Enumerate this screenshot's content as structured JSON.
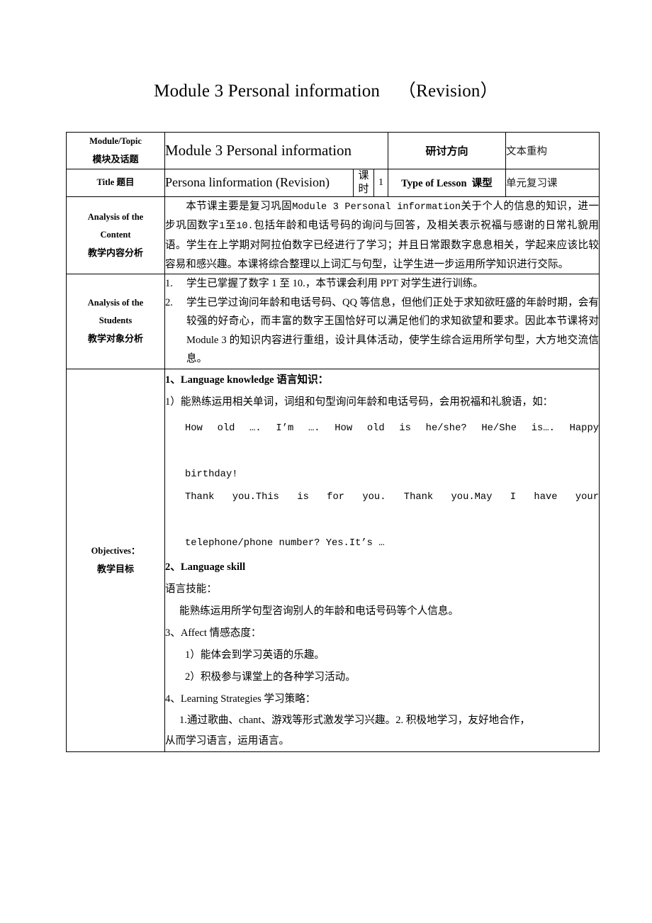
{
  "document": {
    "title": "Module 3 Personal information    （Revision）"
  },
  "table": {
    "row_module": {
      "label_en": "Module/Topic",
      "label_cn": "模块及话题",
      "value": "Module 3 Personal information",
      "direction_label": "研讨方向",
      "direction_value": "文本重构"
    },
    "row_title": {
      "label": "Title  题目",
      "value": "Persona linformation (Revision)",
      "hours_label_1": "课",
      "hours_label_2": "时",
      "hours_value": "1",
      "type_label": "Type of Lesson  课型",
      "type_value": "单元复习课"
    },
    "row_content": {
      "label_en_line1": "Analysis of the",
      "label_en_line2": "Content",
      "label_cn": "教学内容分析",
      "paragraph_part1": "本节课主要是复习巩固",
      "paragraph_mono1": "Module 3 Personal  information",
      "paragraph_part2": "关于个人的信息的知识，进一步巩固数字",
      "paragraph_mono2": "1",
      "paragraph_part3": "至",
      "paragraph_mono3": "10.",
      "paragraph_part4": "包括年龄和电话号码的询问与回答，及相关表示祝福与感谢的日常礼貌用语。学生在上学期对阿拉伯数字已经进行了学习；并且日常跟数字息息相关，学起来应该比较容易和感兴趣。本课将综合整理以上词汇与句型，让学生进一步运用所学知识进行交际。"
    },
    "row_students": {
      "label_en_line1": "Analysis of the",
      "label_en_line2": "Students",
      "label_cn": "教学对象分析",
      "items": [
        {
          "marker": "1.",
          "text": "学生已掌握了数字 1 至 10.，本节课会利用 PPT 对学生进行训练。"
        },
        {
          "marker": "2.",
          "text": "学生已学过询问年龄和电话号码、QQ 等信息，但他们正处于求知欲旺盛的年龄时期，会有较强的好奇心，而丰富的数字王国恰好可以满足他们的求知欲望和要求。因此本节课将对 Module   3 的知识内容进行重组，设计具体活动，使学生综合运用所学句型，大方地交流信息。"
        }
      ]
    },
    "row_objectives": {
      "label_en": "Objectives：",
      "label_cn": "教学目标",
      "line_1": "1、Language knowledge 语言知识：",
      "line_2": "1）能熟练运用相关单词，词组和句型询问年龄和电话号码，会用祝福和礼貌语，如：",
      "example_line_1": "How old ….  I’m    ….  How old is he/she? He/She is….  Happy",
      "example_line_2": "birthday!",
      "example_line_3": "Thank  you.This  is  for  you.  Thank  you.May  I  have  your",
      "example_line_4": "telephone/phone number? Yes.It’s …",
      "line_3": "2、Language skill",
      "line_4": "语言技能：",
      "line_5": "能熟练运用所学句型咨询别人的年龄和电话号码等个人信息。",
      "line_6": "3、Affect 情感态度：",
      "line_7": "1）能体会到学习英语的乐趣。",
      "line_8": "2）积极参与课堂上的各种学习活动。",
      "line_9": "4、Learning Strategies 学习策略：",
      "line_10": "1.通过歌曲、chant、游戏等形式激发学习兴趣。2.  积极地学习，友好地合作，",
      "line_11": "从而学习语言，运用语言。"
    }
  }
}
